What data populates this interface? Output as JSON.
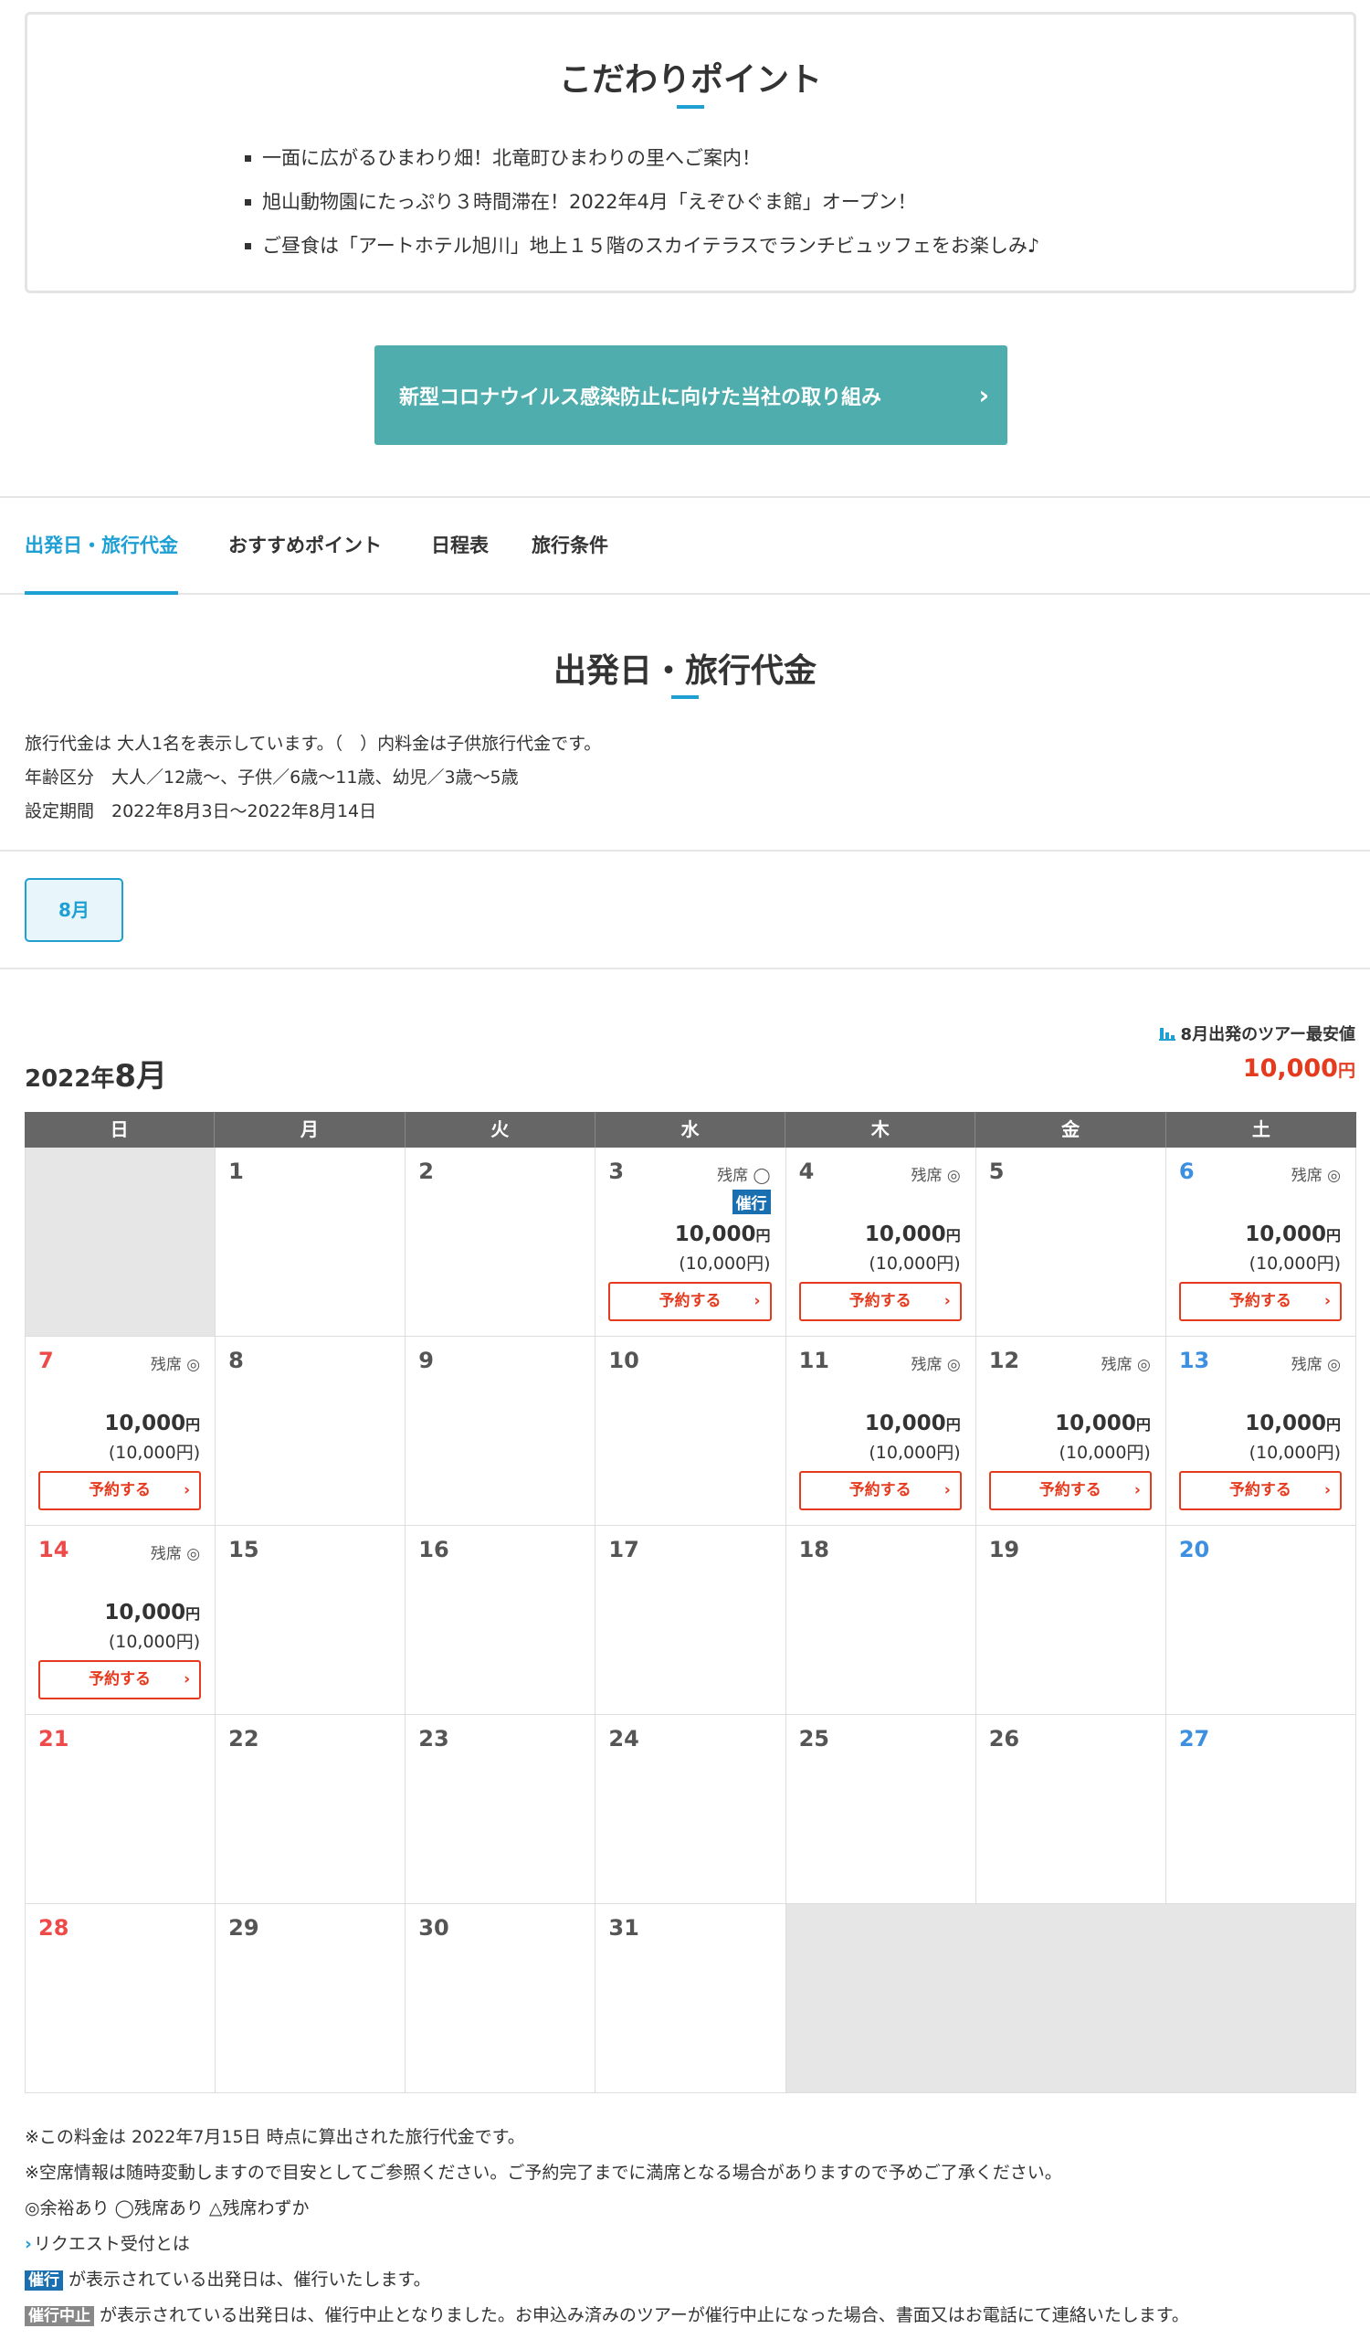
{
  "points": {
    "title": "こだわりポイント",
    "items": [
      "一面に広がるひまわり畑！北竜町ひまわりの里へご案内！",
      "旭山動物園にたっぷり３時間滞在！2022年4月「えぞひぐま館」オープン！",
      "ご昼食は「アートホテル旭川」地上１５階のスカイテラスでランチビュッフェをお楽しみ♪"
    ]
  },
  "covid_button": {
    "label": "新型コロナウイルス感染防止に向けた当社の取り組み",
    "chevron": "›"
  },
  "tabs": [
    "出発日・旅行代金",
    "おすすめポイント",
    "日程表",
    "旅行条件"
  ],
  "section": {
    "title": "出発日・旅行代金",
    "info": [
      "旅行代金は 大人1名を表示しています。（　）内料金は子供旅行代金です。",
      "年齢区分　大人／12歳〜、子供／6歳〜11歳、幼児／3歳〜5歳",
      "設定期間　2022年8月3日〜2022年8月14日"
    ]
  },
  "month_tab": "8月",
  "calendar": {
    "year_label": "2022年",
    "month_label": "8月",
    "lowest_label": "8月出発のツアー最安値",
    "lowest_price": "10,000",
    "yen": "円",
    "weekdays": [
      "日",
      "月",
      "火",
      "水",
      "木",
      "金",
      "土"
    ],
    "reserve_label": "予約する",
    "reserve_chevron": "›",
    "days": [
      {
        "day": "1"
      },
      {
        "day": "2"
      },
      {
        "day": "3",
        "seat": "残席 ◯",
        "badge": "催行",
        "price": "10,000",
        "child": "(10,000円)"
      },
      {
        "day": "4",
        "seat": "残席 ◎",
        "price": "10,000",
        "child": "(10,000円)"
      },
      {
        "day": "5"
      },
      {
        "day": "6",
        "seat": "残席 ◎",
        "price": "10,000",
        "child": "(10,000円)"
      },
      {
        "day": "7",
        "seat": "残席 ◎",
        "price": "10,000",
        "child": "(10,000円)"
      },
      {
        "day": "8"
      },
      {
        "day": "9"
      },
      {
        "day": "10"
      },
      {
        "day": "11",
        "seat": "残席 ◎",
        "price": "10,000",
        "child": "(10,000円)"
      },
      {
        "day": "12",
        "seat": "残席 ◎",
        "price": "10,000",
        "child": "(10,000円)"
      },
      {
        "day": "13",
        "seat": "残席 ◎",
        "price": "10,000",
        "child": "(10,000円)"
      },
      {
        "day": "14",
        "seat": "残席 ◎",
        "price": "10,000",
        "child": "(10,000円)"
      },
      {
        "day": "15"
      },
      {
        "day": "16"
      },
      {
        "day": "17"
      },
      {
        "day": "18"
      },
      {
        "day": "19"
      },
      {
        "day": "20"
      },
      {
        "day": "21"
      },
      {
        "day": "22"
      },
      {
        "day": "23"
      },
      {
        "day": "24"
      },
      {
        "day": "25"
      },
      {
        "day": "26"
      },
      {
        "day": "27"
      },
      {
        "day": "28"
      },
      {
        "day": "29"
      },
      {
        "day": "30"
      },
      {
        "day": "31"
      }
    ]
  },
  "notes": {
    "line1": "※この料金は 2022年7月15日 時点に算出された旅行代金です。",
    "line2": "※空席情報は随時変動しますので目安としてご参照ください。ご予約完了までに満席となる場合がありますので予めご了承ください。",
    "line3": "◎余裕あり ◯残席あり △残席わずか",
    "request_link": "リクエスト受付とは",
    "tag_go": "催行",
    "line5": "が表示されている出発日は、催行いたします。",
    "tag_cancel": "催行中止",
    "line6": "が表示されている出発日は、催行中止となりました。お申込み済みのツアーが催行中止になった場合、書面又はお電話にて連絡いたします。"
  }
}
